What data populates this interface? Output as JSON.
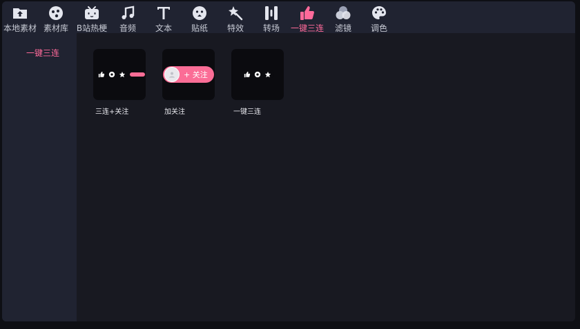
{
  "toolbar": {
    "items": [
      {
        "id": "local",
        "label": "本地素材",
        "icon": "upload-folder-icon"
      },
      {
        "id": "library",
        "label": "素材库",
        "icon": "materials-icon"
      },
      {
        "id": "bili",
        "label": "B站热梗",
        "icon": "bilibili-tv-icon"
      },
      {
        "id": "audio",
        "label": "音频",
        "icon": "music-note-icon"
      },
      {
        "id": "text",
        "label": "文本",
        "icon": "text-t-icon"
      },
      {
        "id": "sticker",
        "label": "贴纸",
        "icon": "sticker-icon"
      },
      {
        "id": "effects",
        "label": "特效",
        "icon": "magic-wand-icon"
      },
      {
        "id": "transition",
        "label": "转场",
        "icon": "transition-icon"
      },
      {
        "id": "triple",
        "label": "一键三连",
        "icon": "thumbs-up-icon",
        "active": true
      },
      {
        "id": "filter",
        "label": "滤镜",
        "icon": "filter-circles-icon"
      },
      {
        "id": "color",
        "label": "调色",
        "icon": "palette-icon"
      }
    ]
  },
  "sidebar": {
    "items": [
      {
        "label": "一键三连",
        "active": true
      }
    ]
  },
  "cards": [
    {
      "caption": "三连+关注"
    },
    {
      "caption": "加关注",
      "follow_text": "+ 关注"
    },
    {
      "caption": "一键三连"
    }
  ],
  "colors": {
    "accent": "#ff6a9a",
    "panel": "#202331",
    "content": "#181921"
  }
}
